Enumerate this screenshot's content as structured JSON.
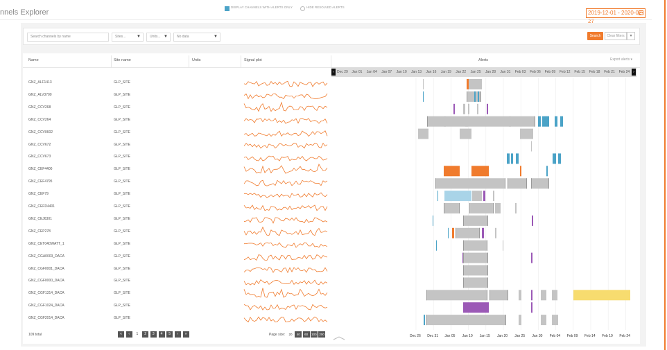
{
  "header": {
    "title": "nnels Explorer",
    "date_range": "2019-12-01 - 2020-02-27"
  },
  "filters": {
    "search_placeholder": "Search channels by name",
    "sites": "Sites...",
    "units": "Units...",
    "date": "No data",
    "display_alerts_label": "DISPLAY CHANNELS WITH ALERTS ONLY",
    "hide_resolved_label": "HIDE RESOLVED ALERTS",
    "search_btn": "Search",
    "clear_btn": "Clear filters"
  },
  "table": {
    "columns": {
      "name": "Name",
      "site": "Site name",
      "units": "Units",
      "signal": "Signal plot",
      "alerts": "Alerts"
    },
    "export_label": "Export alerts ▾",
    "scale_dates": [
      "Dec 29",
      "Jan 01",
      "Jan 04",
      "Jan 07",
      "Jan 10",
      "Jan 13",
      "Jan 16",
      "Jan 19",
      "Jan 22",
      "Jan 25",
      "Jan 28",
      "Jan 31",
      "Feb 03",
      "Feb 06",
      "Feb 09",
      "Feb 12",
      "Feb 15",
      "Feb 18",
      "Feb 21",
      "Feb 24"
    ],
    "axis_dates": [
      "Dec 26",
      "Dec 31",
      "Jan 05",
      "Jan 10",
      "Jan 15",
      "Jan 20",
      "Jan 25",
      "Jan 30",
      "Feb 04",
      "Feb 09",
      "Feb 14",
      "Feb 19",
      "Feb 24"
    ],
    "rows": [
      {
        "name": "GNZ_ALF1413",
        "site": "GLP_SITE"
      },
      {
        "name": "GNZ_ALV3700",
        "site": "GLP_SITE"
      },
      {
        "name": "GNZ_CCV268",
        "site": "GLP_SITE"
      },
      {
        "name": "GNZ_CCV264",
        "site": "GLP_SITE"
      },
      {
        "name": "GNZ_CCV0602",
        "site": "GLP_SITE"
      },
      {
        "name": "GNZ_CCV672",
        "site": "GLP_SITE"
      },
      {
        "name": "GNZ_CCV673",
        "site": "GLP_SITE"
      },
      {
        "name": "GNZ_CEF4400",
        "site": "GLP_SITE"
      },
      {
        "name": "GNZ_CEF4795",
        "site": "GLP_SITE"
      },
      {
        "name": "GNZ_CEF79",
        "site": "GLP_SITE"
      },
      {
        "name": "GNZ_CEFD4401",
        "site": "GLP_SITE"
      },
      {
        "name": "GNZ_CEJ6301",
        "site": "GLP_SITE"
      },
      {
        "name": "GNZ_CEP278",
        "site": "GLP_SITE"
      },
      {
        "name": "GNZ_CET04DWATT_1",
        "site": "GLP_SITE"
      },
      {
        "name": "GNZ_CGA0003_DACA",
        "site": "GLP_SITE"
      },
      {
        "name": "GNZ_CGF0001_DACA",
        "site": "GLP_SITE"
      },
      {
        "name": "GNZ_CGF0000_DACA",
        "site": "GLP_SITE"
      },
      {
        "name": "GNZ_CGF1314_DACA",
        "site": "GLP_SITE"
      },
      {
        "name": "GNZ_CGF1024_DACA",
        "site": "GLP_SITE"
      },
      {
        "name": "GNZ_CGF2014_DACA",
        "site": "GLP_SITE"
      }
    ]
  },
  "footer": {
    "total": "109 total",
    "pages": [
      "«",
      "‹",
      "1",
      "2",
      "3",
      "4",
      "5",
      "›",
      "»"
    ],
    "current_page": "1",
    "page_size_label": "Page size:",
    "page_sizes": [
      "20",
      "40",
      "60",
      "100",
      "200"
    ]
  },
  "colors": {
    "accent": "#f07b2d",
    "teal": "#4ba3c7",
    "purple": "#9b59b6",
    "gray": "#c4c4c4",
    "yellow": "#f7dc6f",
    "light_blue": "#a9d4e8"
  }
}
